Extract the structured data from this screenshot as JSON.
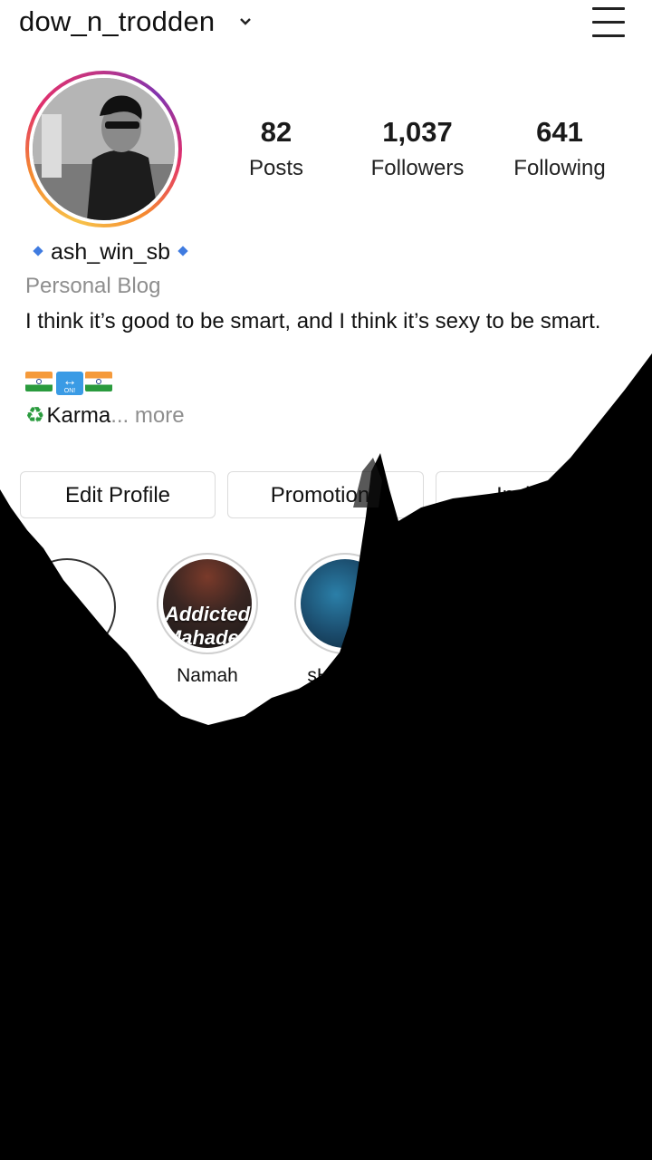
{
  "header": {
    "username": "dow_n_trodden",
    "dropdown_icon": "chevron-down-icon",
    "menu_icon": "hamburger-menu-icon"
  },
  "profile": {
    "stats": [
      {
        "value": "82",
        "label": "Posts"
      },
      {
        "value": "1,037",
        "label": "Followers"
      },
      {
        "value": "641",
        "label": "Following"
      }
    ],
    "name": "ash_win_sb",
    "category": "Personal Blog",
    "bio": "I think it’s good to be smart, and I think it’s sexy to be smart.",
    "emoji_badge": "ON!",
    "karma": "Karma",
    "ellipsis": "...",
    "more": " more"
  },
  "buttons": {
    "edit_profile": "Edit Profile",
    "promotions": "Promotions",
    "insights": "Insights"
  },
  "highlights": [
    {
      "label": "Namah",
      "cover_text": "Addicted Mahadev"
    },
    {
      "label": "sHiva A",
      "cover_text": ""
    }
  ],
  "colors": {
    "accent_blue": "#3f7be0",
    "muted_text": "#8e8e8e",
    "overlay": "#000000"
  }
}
